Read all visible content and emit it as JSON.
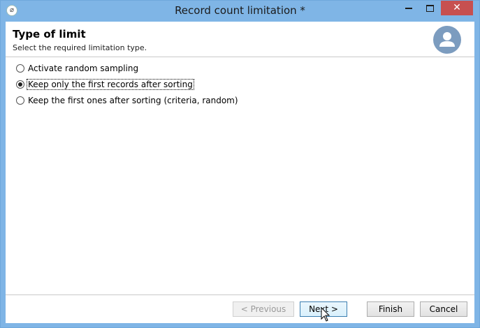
{
  "window": {
    "title": "Record count limitation *",
    "close_glyph": "✕"
  },
  "header": {
    "title": "Type of limit",
    "subtitle": "Select the required limitation type."
  },
  "options": [
    {
      "label": "Activate random sampling",
      "checked": false
    },
    {
      "label": "Keep only the first records after sorting",
      "checked": true
    },
    {
      "label": "Keep the first ones after sorting (criteria, random)",
      "checked": false
    }
  ],
  "buttons": {
    "previous": "< Previous",
    "next": "Next >",
    "finish": "Finish",
    "cancel": "Cancel"
  },
  "icons": {
    "app": "app-icon",
    "avatar": "user-avatar-icon"
  },
  "colors": {
    "titlebar": "#7fb5e6",
    "close": "#c75050",
    "avatar": "#7c9cbf"
  }
}
